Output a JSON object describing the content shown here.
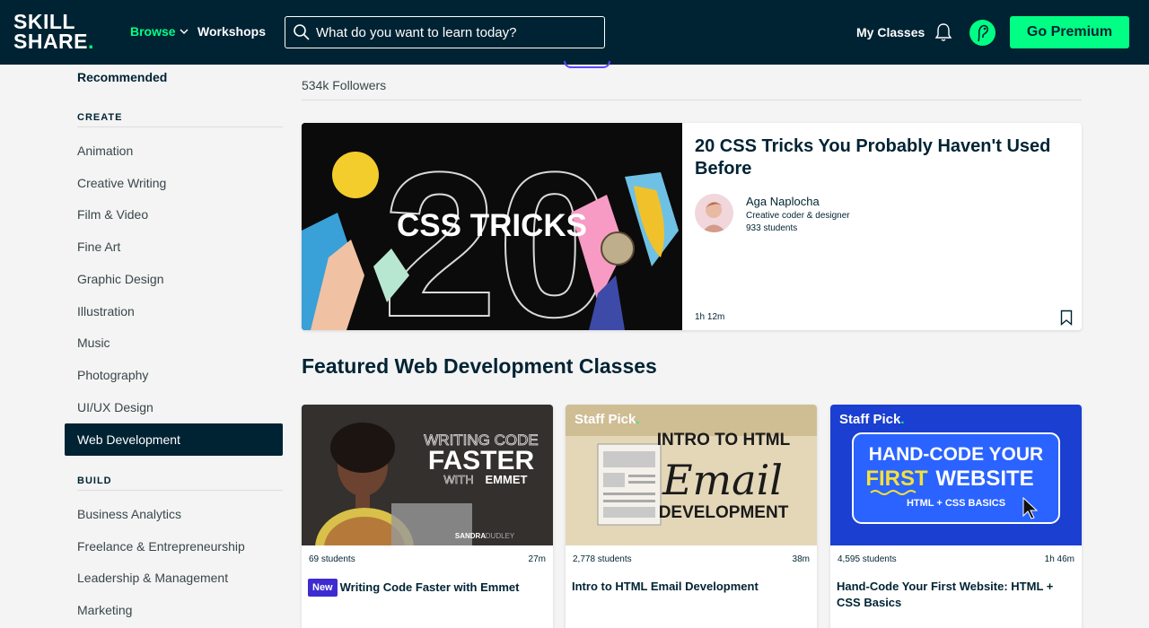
{
  "header": {
    "logo_line1": "SKILL",
    "logo_line2": "SHARE",
    "logo_dot": ".",
    "browse_label": "Browse",
    "workshops_label": "Workshops",
    "search_placeholder": "What do you want to learn today?",
    "my_classes_label": "My Classes",
    "premium_label": "Go Premium"
  },
  "sidebar": {
    "recommended": "Recommended",
    "create_heading": "CREATE",
    "create_items": [
      "Animation",
      "Creative Writing",
      "Film & Video",
      "Fine Art",
      "Graphic Design",
      "Illustration",
      "Music",
      "Photography",
      "UI/UX Design",
      "Web Development"
    ],
    "active_item": "Web Development",
    "build_heading": "BUILD",
    "build_items": [
      "Business Analytics",
      "Freelance & Entrepreneurship",
      "Leadership & Management",
      "Marketing"
    ]
  },
  "main": {
    "followers": "534k Followers",
    "featured": {
      "thumb_text": "CSS TRICKS",
      "thumb_number": "20",
      "title": "20 CSS Tricks You Probably Haven't Used Before",
      "teacher_name": "Aga Naplocha",
      "teacher_role": "Creative coder & designer",
      "students": "933 students",
      "duration": "1h 12m"
    },
    "section_heading": "Featured Web Development Classes",
    "cards": [
      {
        "students": "69 students",
        "duration": "27m",
        "badge": "New",
        "title": "Writing Code Faster with Emmet",
        "thumb_line1": "WRITING CODE",
        "thumb_line2": "FASTER",
        "thumb_line3": "WITH",
        "thumb_line3b": "EMMET",
        "thumb_author": "SANDRA",
        "thumb_author_b": "DUDLEY"
      },
      {
        "students": "2,778 students",
        "duration": "38m",
        "staff_pick": "Staff Pick",
        "title": "Intro to HTML Email Development",
        "thumb_line1": "INTRO TO HTML",
        "thumb_line2": "Email",
        "thumb_line3": "DEVELOPMENT"
      },
      {
        "students": "4,595 students",
        "duration": "1h 46m",
        "staff_pick": "Staff Pick",
        "title": "Hand-Code Your First Website: HTML + CSS Basics",
        "thumb_line1": "HAND-CODE YOUR",
        "thumb_line2a": "FIRST",
        "thumb_line2b": "WEBSITE",
        "thumb_line3": "HTML + CSS BASICS"
      }
    ]
  },
  "colors": {
    "navy": "#002333",
    "green": "#00ff84",
    "new_badge": "#3d2bd1",
    "card_blue": "#1a3fd1"
  },
  "icons": [
    "chevron-down-icon",
    "search-icon",
    "bell-icon",
    "avatar",
    "bookmark-icon"
  ]
}
